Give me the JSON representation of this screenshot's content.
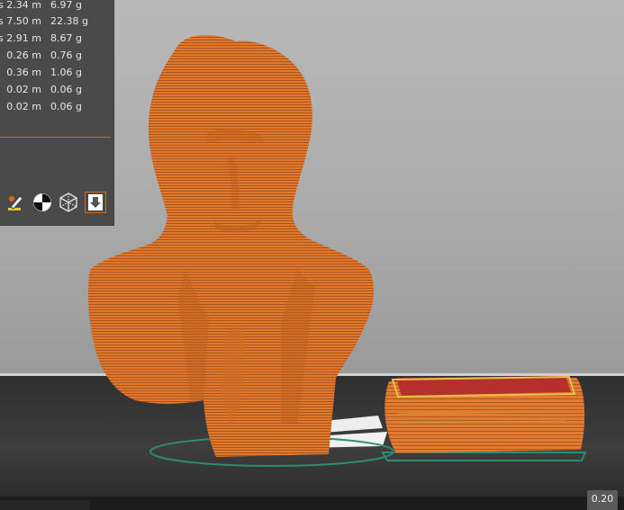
{
  "filament_stats": [
    {
      "mark": "s",
      "length": "2.34 m",
      "weight": "6.97 g"
    },
    {
      "mark": "s",
      "length": "7.50 m",
      "weight": "22.38 g"
    },
    {
      "mark": "s",
      "length": "2.91 m",
      "weight": "8.67 g"
    },
    {
      "mark": "",
      "length": "0.26 m",
      "weight": "0.76 g"
    },
    {
      "mark": "",
      "length": "0.36 m",
      "weight": "1.06 g"
    },
    {
      "mark": "",
      "length": "0.02 m",
      "weight": "0.06 g"
    },
    {
      "mark": "",
      "length": "0.02 m",
      "weight": "0.06 g"
    }
  ],
  "toolbar": {
    "icons": [
      "paint-brush-icon",
      "center-of-mass-icon",
      "wireframe-cube-icon",
      "download-arrow-icon"
    ]
  },
  "scale_badge": "0.20",
  "colors": {
    "accent": "#d46a1c",
    "model_orange": "#e0762c",
    "model_red": "#b5302c",
    "skirt_teal": "#2e8c72",
    "panel_bg": "#4a4a4a"
  }
}
